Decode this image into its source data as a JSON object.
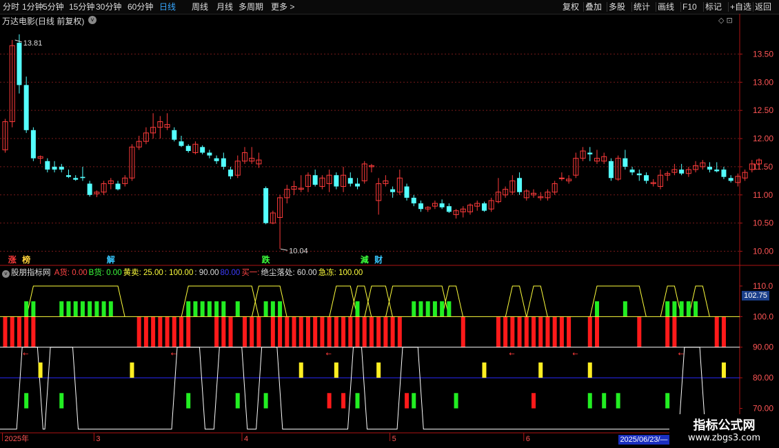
{
  "toolbar": {
    "periods": [
      "分时",
      "1分钟",
      "5分钟",
      "15分钟",
      "30分钟",
      "60分钟",
      "日线",
      "周线",
      "月线",
      "多周期",
      "更多 >"
    ],
    "active_period": "日线",
    "tools": [
      "复权",
      "叠加",
      "多股",
      "统计",
      "画线",
      "F10",
      "标记",
      "+自选",
      "返回"
    ]
  },
  "main_chart": {
    "title": "万达电影(日线 前复权)",
    "high_label": "13.81",
    "low_label": "10.04",
    "y_ticks": [
      "13.50",
      "13.00",
      "12.50",
      "12.00",
      "11.50",
      "11.00",
      "10.50",
      "10.00"
    ],
    "y_range": [
      9.75,
      13.97
    ],
    "signals": [
      {
        "text": "涨",
        "color": "#ff3b3b",
        "day": 1
      },
      {
        "text": "榜",
        "color": "#ffd23b",
        "day": 3
      },
      {
        "text": "解",
        "color": "#37c8ff",
        "day": 15
      },
      {
        "text": "跌",
        "color": "#3bff3b",
        "day": 37
      },
      {
        "text": "減",
        "color": "#3bff3b",
        "day": 51
      },
      {
        "text": "财",
        "color": "#37c8ff",
        "day": 53
      }
    ],
    "candles": [
      [
        11.8,
        12.35,
        11.75,
        12.3
      ],
      [
        12.3,
        13.75,
        12.2,
        13.65
      ],
      [
        13.7,
        13.85,
        12.8,
        12.95
      ],
      [
        12.95,
        13.1,
        12.1,
        12.15
      ],
      [
        12.15,
        12.2,
        11.6,
        11.65
      ],
      [
        11.65,
        11.7,
        11.55,
        11.68
      ],
      [
        11.6,
        11.65,
        11.4,
        11.45
      ],
      [
        11.5,
        11.6,
        11.4,
        11.45
      ],
      [
        11.5,
        11.55,
        11.4,
        11.45
      ],
      [
        11.35,
        11.45,
        11.3,
        11.32
      ],
      [
        11.3,
        11.35,
        11.25,
        11.27
      ],
      [
        11.32,
        11.5,
        11.25,
        11.3
      ],
      [
        11.2,
        11.25,
        10.97,
        11.0
      ],
      [
        11.02,
        11.08,
        10.96,
        11.05
      ],
      [
        11.05,
        11.25,
        11.0,
        11.2
      ],
      [
        11.2,
        11.3,
        11.1,
        11.25
      ],
      [
        11.2,
        11.25,
        11.08,
        11.1
      ],
      [
        11.2,
        11.35,
        11.15,
        11.3
      ],
      [
        11.3,
        11.9,
        11.25,
        11.85
      ],
      [
        11.85,
        12.05,
        11.8,
        11.95
      ],
      [
        11.95,
        12.2,
        11.9,
        12.1
      ],
      [
        12.1,
        12.45,
        12.0,
        12.2
      ],
      [
        12.2,
        12.4,
        12.0,
        12.3
      ],
      [
        12.2,
        12.45,
        12.15,
        12.25
      ],
      [
        12.15,
        12.2,
        11.95,
        11.98
      ],
      [
        11.95,
        12.05,
        11.85,
        11.87
      ],
      [
        11.87,
        11.9,
        11.75,
        11.78
      ],
      [
        11.75,
        11.95,
        11.72,
        11.9
      ],
      [
        11.85,
        11.88,
        11.72,
        11.75
      ],
      [
        11.75,
        11.8,
        11.65,
        11.7
      ],
      [
        11.65,
        11.7,
        11.55,
        11.6
      ],
      [
        11.65,
        11.75,
        11.45,
        11.5
      ],
      [
        11.45,
        11.5,
        11.28,
        11.33
      ],
      [
        11.35,
        11.7,
        11.3,
        11.6
      ],
      [
        11.6,
        11.85,
        11.55,
        11.75
      ],
      [
        11.6,
        11.85,
        11.55,
        11.65
      ],
      [
        11.55,
        11.75,
        11.48,
        11.62
      ],
      [
        11.12,
        11.15,
        10.48,
        10.5
      ],
      [
        10.5,
        10.72,
        10.48,
        10.68
      ],
      [
        10.6,
        11.0,
        10.04,
        10.95
      ],
      [
        10.95,
        11.18,
        10.85,
        11.1
      ],
      [
        11.1,
        11.25,
        11.0,
        11.15
      ],
      [
        11.1,
        11.35,
        11.05,
        11.12
      ],
      [
        11.15,
        11.4,
        11.05,
        11.35
      ],
      [
        11.35,
        11.45,
        11.15,
        11.18
      ],
      [
        11.15,
        11.35,
        11.1,
        11.3
      ],
      [
        11.2,
        11.45,
        11.05,
        11.35
      ],
      [
        11.35,
        11.4,
        11.1,
        11.15
      ],
      [
        11.15,
        11.5,
        11.05,
        11.35
      ],
      [
        11.3,
        11.4,
        11.15,
        11.2
      ],
      [
        11.2,
        11.3,
        11.1,
        11.15
      ],
      [
        11.25,
        11.6,
        11.2,
        11.55
      ],
      [
        11.5,
        11.55,
        11.4,
        11.52
      ],
      [
        10.9,
        11.3,
        10.65,
        11.2
      ],
      [
        11.2,
        11.35,
        11.15,
        11.25
      ],
      [
        11.1,
        11.15,
        10.95,
        11.05
      ],
      [
        11.05,
        11.45,
        11.0,
        11.3
      ],
      [
        11.15,
        11.2,
        10.9,
        10.95
      ],
      [
        10.95,
        11.0,
        10.8,
        10.85
      ],
      [
        10.85,
        10.9,
        10.7,
        10.75
      ],
      [
        10.75,
        10.8,
        10.7,
        10.78
      ],
      [
        10.8,
        10.9,
        10.75,
        10.85
      ],
      [
        10.85,
        10.92,
        10.75,
        10.78
      ],
      [
        10.8,
        10.85,
        10.68,
        10.7
      ],
      [
        10.65,
        10.75,
        10.58,
        10.72
      ],
      [
        10.7,
        10.8,
        10.6,
        10.75
      ],
      [
        10.7,
        10.85,
        10.65,
        10.82
      ],
      [
        10.8,
        10.9,
        10.72,
        10.85
      ],
      [
        10.85,
        10.88,
        10.7,
        10.72
      ],
      [
        10.75,
        10.95,
        10.7,
        10.9
      ],
      [
        10.88,
        11.3,
        10.85,
        11.05
      ],
      [
        11.0,
        11.15,
        10.95,
        11.1
      ],
      [
        11.05,
        11.35,
        11.0,
        11.25
      ],
      [
        11.3,
        11.4,
        11.0,
        11.05
      ],
      [
        10.95,
        11.1,
        10.9,
        11.07
      ],
      [
        11.0,
        11.1,
        10.95,
        11.03
      ],
      [
        10.95,
        11.05,
        10.9,
        10.97
      ],
      [
        10.95,
        11.1,
        10.9,
        11.05
      ],
      [
        11.05,
        11.25,
        11.0,
        11.2
      ],
      [
        11.3,
        11.4,
        11.25,
        11.3
      ],
      [
        11.25,
        11.35,
        11.2,
        11.28
      ],
      [
        11.35,
        11.75,
        11.3,
        11.65
      ],
      [
        11.65,
        11.85,
        11.6,
        11.78
      ],
      [
        11.75,
        11.85,
        11.6,
        11.72
      ],
      [
        11.6,
        11.8,
        11.55,
        11.65
      ],
      [
        11.6,
        11.75,
        11.55,
        11.68
      ],
      [
        11.6,
        11.65,
        11.25,
        11.3
      ],
      [
        11.28,
        11.7,
        11.25,
        11.65
      ],
      [
        11.65,
        11.8,
        11.45,
        11.5
      ],
      [
        11.45,
        11.5,
        11.35,
        11.4
      ],
      [
        11.38,
        11.45,
        11.25,
        11.35
      ],
      [
        11.35,
        11.4,
        11.2,
        11.25
      ],
      [
        11.2,
        11.28,
        11.15,
        11.22
      ],
      [
        11.15,
        11.45,
        11.1,
        11.35
      ],
      [
        11.35,
        11.42,
        11.25,
        11.38
      ],
      [
        11.4,
        11.55,
        11.35,
        11.45
      ],
      [
        11.45,
        11.55,
        11.35,
        11.38
      ],
      [
        11.38,
        11.5,
        11.32,
        11.45
      ],
      [
        11.45,
        11.6,
        11.4,
        11.52
      ],
      [
        11.5,
        11.62,
        11.45,
        11.57
      ],
      [
        11.5,
        11.58,
        11.4,
        11.45
      ],
      [
        11.45,
        11.58,
        11.4,
        11.42
      ],
      [
        11.45,
        11.5,
        11.28,
        11.32
      ],
      [
        11.3,
        11.35,
        11.22,
        11.25
      ],
      [
        11.22,
        11.38,
        11.15,
        11.33
      ],
      [
        11.3,
        11.45,
        11.25,
        11.4
      ],
      [
        11.45,
        11.62,
        11.4,
        11.55
      ],
      [
        11.55,
        11.65,
        11.45,
        11.62
      ]
    ]
  },
  "indicator": {
    "name": "股朋指标网",
    "fields": [
      {
        "text": "A货: 0.00",
        "color": "#ff4545"
      },
      {
        "text": "B货: 0.00",
        "color": "#3cff3c"
      },
      {
        "text": "黄卖: 25.00",
        "color": "#ffff3c"
      },
      {
        "text": ": 100.00",
        "color": "#ffff3c"
      },
      {
        "text": ": 90.00",
        "color": "#dddddd"
      },
      {
        "text": "80.00",
        "color": "#3c3cff"
      },
      {
        "text": "买一:",
        "color": "#ff4545"
      },
      {
        "text": "绝尘落处: 60.00",
        "color": "#dddddd"
      },
      {
        "text": "急冻: 100.00",
        "color": "#ffff3c"
      }
    ],
    "y_ticks": [
      "110.0",
      "100.0",
      "90.00",
      "80.00",
      "70.00"
    ],
    "y_range": [
      62.0,
      114.5
    ],
    "current_value": "102.75",
    "red_bars": [
      0,
      1,
      2,
      3,
      4,
      19,
      20,
      21,
      22,
      23,
      24,
      25,
      26,
      30,
      31,
      32,
      34,
      35,
      36,
      38,
      39,
      40,
      41,
      42,
      43,
      44,
      45,
      46,
      47,
      48,
      49,
      50,
      51,
      52,
      53,
      54,
      55,
      56,
      65,
      70,
      71,
      72,
      73,
      74,
      75,
      76,
      77,
      78,
      79,
      80,
      83,
      84,
      90,
      94,
      95,
      101,
      102
    ],
    "green_top": [
      3,
      4,
      8,
      9,
      10,
      11,
      12,
      13,
      14,
      15,
      26,
      27,
      28,
      29,
      30,
      31,
      33,
      37,
      38,
      39,
      50,
      58,
      59,
      60,
      61,
      62,
      63,
      84,
      88,
      94,
      95,
      96,
      97,
      98
    ],
    "yellow_peaks": [
      [
        4,
        16
      ],
      [
        26,
        35
      ],
      [
        36,
        39
      ],
      [
        47,
        49
      ],
      [
        50,
        51
      ],
      [
        52,
        54
      ],
      [
        55,
        62
      ],
      [
        63,
        64
      ],
      [
        72,
        73
      ],
      [
        75,
        76
      ],
      [
        84,
        90
      ],
      [
        94,
        95
      ],
      [
        98,
        99
      ]
    ],
    "white_peaks": [
      [
        3,
        4
      ],
      [
        7,
        9
      ],
      [
        25,
        27
      ],
      [
        31,
        33
      ],
      [
        37,
        38
      ],
      [
        50,
        50
      ],
      [
        57,
        58
      ],
      [
        97,
        98
      ]
    ],
    "yellow_mid": [
      5,
      18,
      42,
      47,
      53,
      68,
      76,
      83,
      102
    ],
    "green_low": [
      3,
      8,
      26,
      33,
      37,
      50,
      58,
      64,
      83,
      85,
      87,
      94
    ],
    "red_low": [
      46,
      48,
      57,
      75
    ],
    "arrows": [
      3,
      24,
      46,
      72,
      81,
      96
    ]
  },
  "x_axis": {
    "labels": [
      "2025年",
      "3",
      "4",
      "5",
      "6"
    ],
    "label_days": [
      0,
      13,
      34,
      55,
      74
    ],
    "current_date": "2025/06/23/—"
  },
  "watermark": {
    "line1": "指标公式网",
    "line2": "www.zbgs3.com"
  },
  "colors": {
    "up": "#ff3b3b",
    "down": "#54ffff",
    "grid": "#7a1a1a",
    "axis": "#b01515"
  }
}
